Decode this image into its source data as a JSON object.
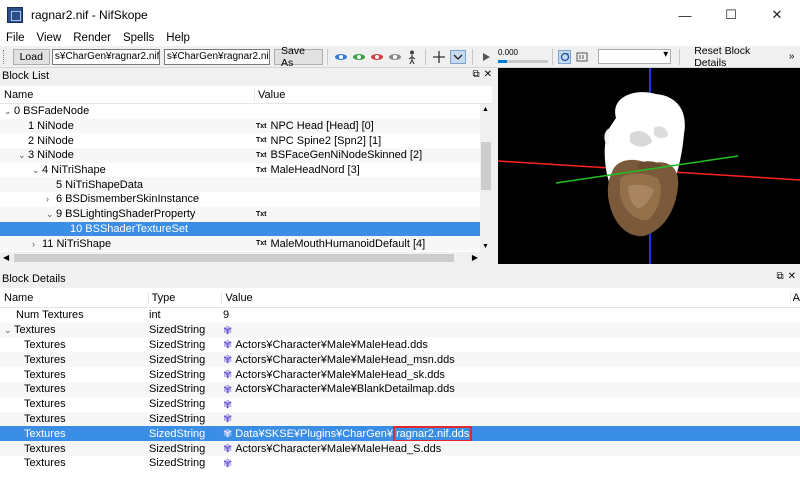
{
  "window": {
    "title": "ragnar2.nif - NifSkope",
    "controls": {
      "minimize": "—",
      "maximize": "☐",
      "close": "✕"
    }
  },
  "menu": [
    "File",
    "View",
    "Render",
    "Spells",
    "Help"
  ],
  "toolbar": {
    "load_label": "Load",
    "load_path": "s¥CharGen¥ragnar2.nif",
    "save_path": "s¥CharGen¥ragnar2.nif",
    "save_as_label": "Save As",
    "slider_value": "0.000",
    "slider_fraction": 0.18,
    "reset_label": "Reset Block Details"
  },
  "block_list": {
    "title": "Block List",
    "columns": [
      "Name",
      "Value"
    ],
    "rows": [
      {
        "name": "0 BSFadeNode",
        "value": "",
        "indent": 0,
        "arrow": "⌄",
        "txt": false
      },
      {
        "name": "1 NiNode",
        "value": "NPC Head [Head] [0]",
        "indent": 1,
        "arrow": "",
        "txt": true
      },
      {
        "name": "2 NiNode",
        "value": "NPC Spine2 [Spn2] [1]",
        "indent": 1,
        "arrow": "",
        "txt": true
      },
      {
        "name": "3 NiNode",
        "value": "BSFaceGenNiNodeSkinned [2]",
        "indent": 1,
        "arrow": "⌄",
        "txt": true
      },
      {
        "name": "4 NiTriShape",
        "value": "MaleHeadNord [3]",
        "indent": 2,
        "arrow": "⌄",
        "txt": true
      },
      {
        "name": "5 NiTriShapeData",
        "value": "",
        "indent": 3,
        "arrow": "",
        "txt": false
      },
      {
        "name": "6 BSDismemberSkinInstance",
        "value": "",
        "indent": 3,
        "arrow": "›",
        "txt": false
      },
      {
        "name": "9 BSLightingShaderProperty",
        "value": "",
        "indent": 3,
        "arrow": "⌄",
        "txt": true
      },
      {
        "name": "10 BSShaderTextureSet",
        "value": "",
        "indent": 4,
        "arrow": "",
        "txt": false,
        "selected": true
      },
      {
        "name": "11 NiTriShape",
        "value": "MaleMouthHumanoidDefault [4]",
        "indent": 2,
        "arrow": "›",
        "txt": true
      }
    ]
  },
  "block_details": {
    "title": "Block Details",
    "columns": [
      "Name",
      "Type",
      "Value",
      "A"
    ],
    "rows": [
      {
        "name": "Num Textures",
        "type": "int",
        "value": "9",
        "indent": 1,
        "arrow": "",
        "flower": false
      },
      {
        "name": "Textures",
        "type": "SizedString",
        "value": "",
        "indent": 0,
        "arrow": "⌄",
        "flower": true
      },
      {
        "name": "Textures",
        "type": "SizedString",
        "value": "Actors¥Character¥Male¥MaleHead.dds",
        "indent": 2,
        "arrow": "",
        "flower": true
      },
      {
        "name": "Textures",
        "type": "SizedString",
        "value": "Actors¥Character¥Male¥MaleHead_msn.dds",
        "indent": 2,
        "arrow": "",
        "flower": true
      },
      {
        "name": "Textures",
        "type": "SizedString",
        "value": "Actors¥Character¥Male¥MaleHead_sk.dds",
        "indent": 2,
        "arrow": "",
        "flower": true
      },
      {
        "name": "Textures",
        "type": "SizedString",
        "value": "Actors¥Character¥Male¥BlankDetailmap.dds",
        "indent": 2,
        "arrow": "",
        "flower": true
      },
      {
        "name": "Textures",
        "type": "SizedString",
        "value": "",
        "indent": 2,
        "arrow": "",
        "flower": true
      },
      {
        "name": "Textures",
        "type": "SizedString",
        "value": "",
        "indent": 2,
        "arrow": "",
        "flower": true
      },
      {
        "name": "Textures",
        "type": "SizedString",
        "value": "Data¥SKSE¥Plugins¥CharGen¥",
        "value_highlight": "ragnar2.nif.dds",
        "indent": 2,
        "arrow": "",
        "flower": true,
        "selected": true
      },
      {
        "name": "Textures",
        "type": "SizedString",
        "value": "Actors¥Character¥Male¥MaleHead_S.dds",
        "indent": 2,
        "arrow": "",
        "flower": true
      },
      {
        "name": "Textures",
        "type": "SizedString",
        "value": "",
        "indent": 2,
        "arrow": "",
        "flower": true
      }
    ]
  },
  "colors": {
    "selection": "#3a8ee6",
    "highlight_border": "#e0282e",
    "axis_red": "#ff2020",
    "axis_green": "#20c020",
    "axis_blue": "#2030ff"
  }
}
